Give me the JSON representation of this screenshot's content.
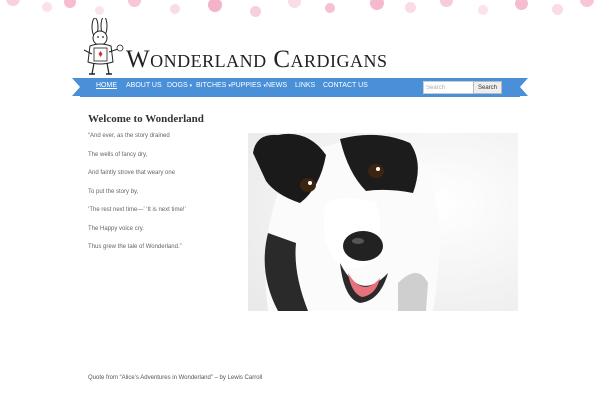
{
  "site": {
    "title": "Wonderland Cardigans",
    "logo_icon": "white-rabbit-icon"
  },
  "nav": {
    "items": [
      {
        "label": "HOME",
        "active": true,
        "dropdown": false
      },
      {
        "label": "ABOUT US",
        "active": false,
        "dropdown": false
      },
      {
        "label": "DOGS",
        "active": false,
        "dropdown": true
      },
      {
        "label": "BITCHES",
        "active": false,
        "dropdown": true
      },
      {
        "label": "PUPPIES",
        "active": false,
        "dropdown": true
      },
      {
        "label": "NEWS",
        "active": false,
        "dropdown": false
      },
      {
        "label": "LINKS",
        "active": false,
        "dropdown": false
      },
      {
        "label": "CONTACT US",
        "active": false,
        "dropdown": false
      }
    ],
    "caret": "▾",
    "color": "#4a90d9"
  },
  "search": {
    "placeholder": "Search",
    "button_label": "Search"
  },
  "main": {
    "title": "Welcome to Wonderland",
    "poem": [
      "“And ever, as the story drained",
      "The wells of fancy dry,",
      "And faintly strove that weary one",
      "To put the story by,",
      "‘The rest next time—’ ‘It is next time!’",
      "The Happy voice cry.",
      "Thus grew the tale of Wonderland.”"
    ],
    "photo_subject": "dog-photo"
  },
  "footer": {
    "quote": "Quote from “Alice’s Adventures in Wonderland” – by Lewis Carroll"
  },
  "colors": {
    "dots": "#f7bcd3",
    "nav": "#4a90d9"
  }
}
